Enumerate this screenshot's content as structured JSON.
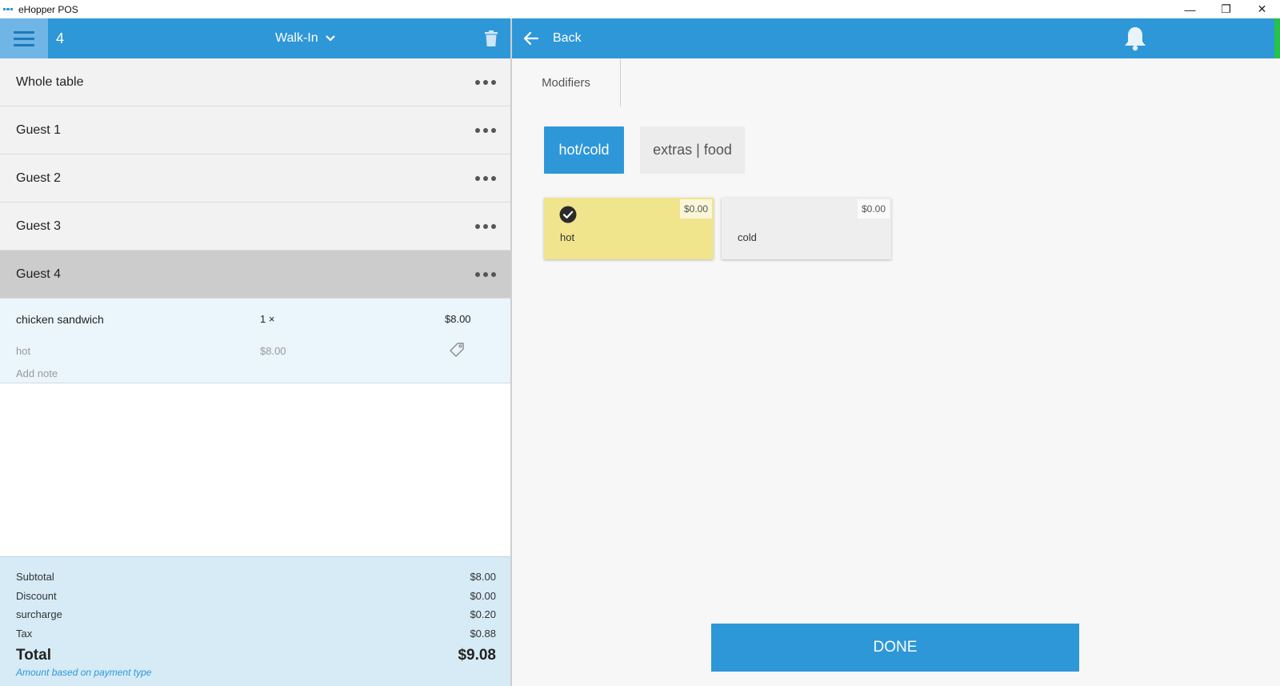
{
  "window": {
    "title": "eHopper POS",
    "controls": {
      "minimize": "—",
      "restore": "❐",
      "close": "✕"
    }
  },
  "order": {
    "number": "4",
    "type": "Walk-In",
    "icons": {
      "menu": "hamburger-icon",
      "dropdown": "chevron-down-icon",
      "delete": "trash-icon"
    }
  },
  "guests": [
    {
      "label": "Whole table",
      "active": false
    },
    {
      "label": "Guest 1",
      "active": false
    },
    {
      "label": "Guest 2",
      "active": false
    },
    {
      "label": "Guest 3",
      "active": false
    },
    {
      "label": "Guest 4",
      "active": true
    }
  ],
  "item": {
    "name": "chicken sandwich",
    "qty": "1 ×",
    "price": "$8.00",
    "modifier": {
      "name": "hot",
      "price": "$8.00"
    },
    "add_note": "Add note"
  },
  "totals": {
    "subtotal": {
      "label": "Subtotal",
      "value": "$8.00"
    },
    "discount": {
      "label": "Discount",
      "value": "$0.00"
    },
    "surcharge": {
      "label": "surcharge",
      "value": "$0.20"
    },
    "tax": {
      "label": "Tax",
      "value": "$0.88"
    },
    "total": {
      "label": "Total",
      "value": "$9.08"
    },
    "note": "Amount based on payment type"
  },
  "right": {
    "back_label": "Back",
    "tab": "Modifiers",
    "categories": [
      {
        "label": "hot/cold",
        "selected": true
      },
      {
        "label": "extras | food",
        "selected": false
      }
    ],
    "modifiers": [
      {
        "label": "hot",
        "price": "$0.00",
        "checked": true
      },
      {
        "label": "cold",
        "price": "$0.00",
        "checked": false
      }
    ],
    "done_label": "DONE",
    "colors": {
      "primary": "#2e97d8",
      "selected_card": "#f0e58d",
      "status_green": "#25c24a"
    }
  }
}
